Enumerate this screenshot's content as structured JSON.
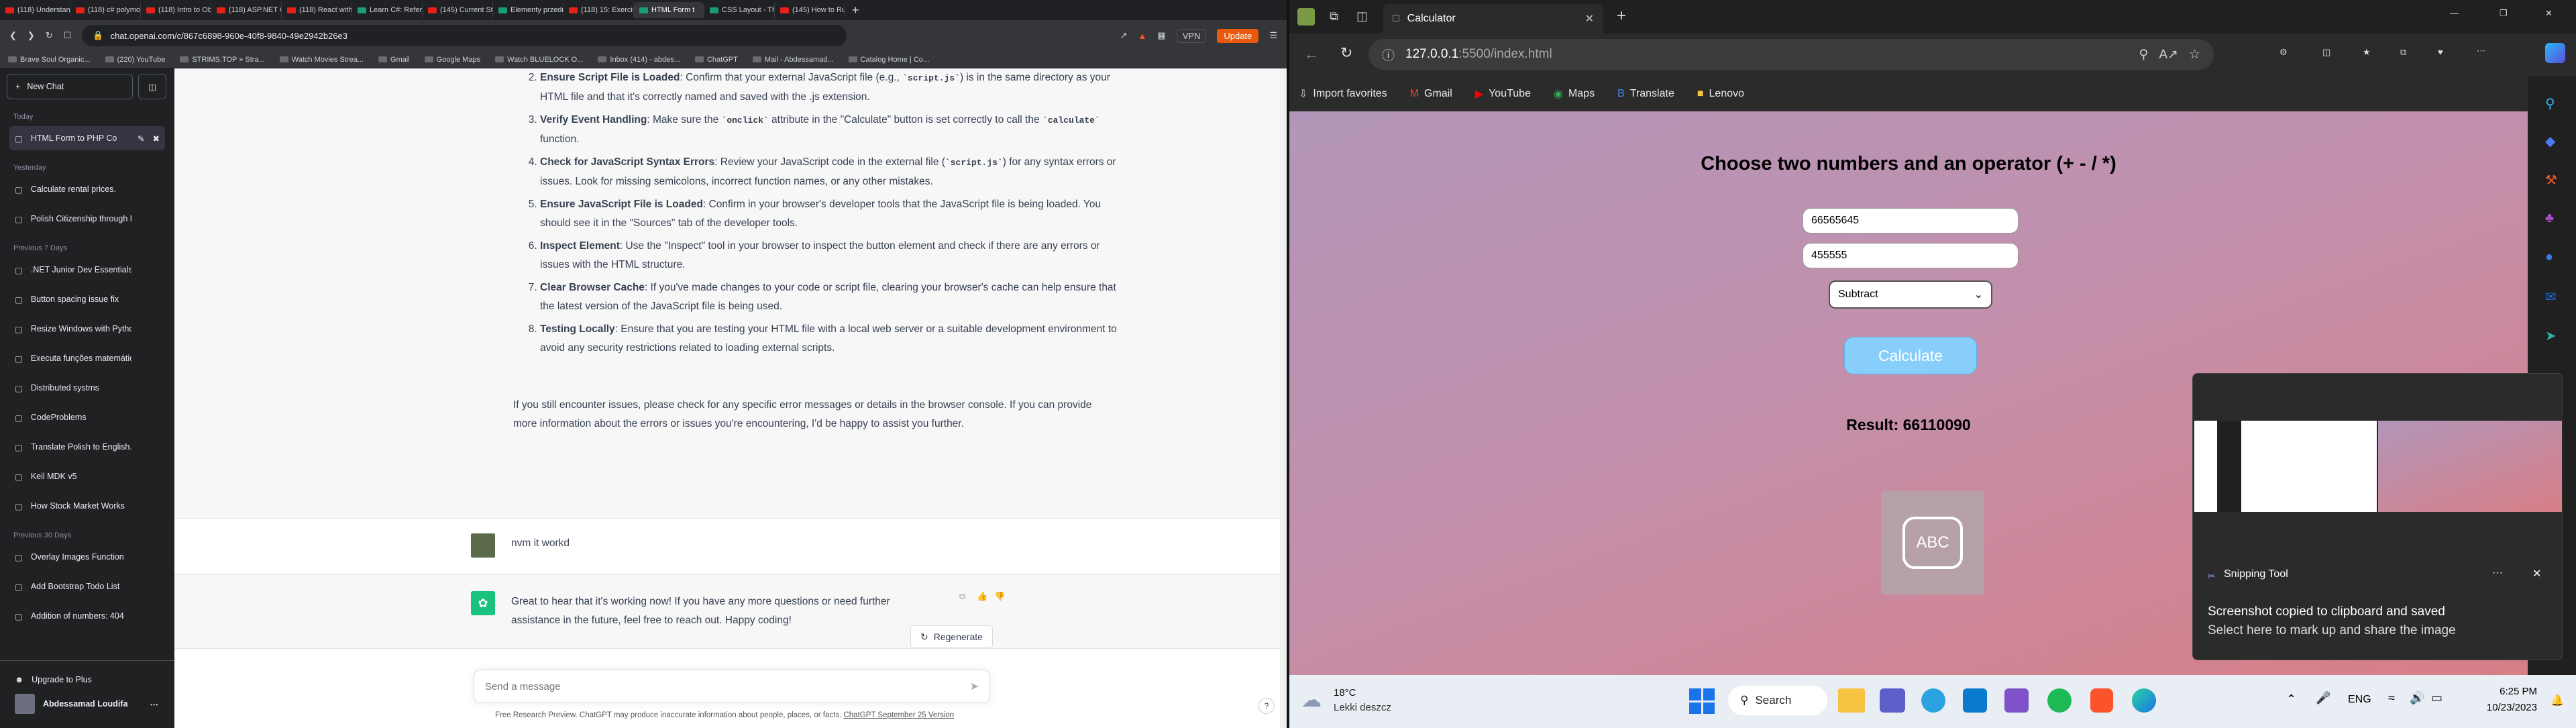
{
  "left_browser": {
    "tabs": [
      "(118) Understand",
      "(118) c# polymor",
      "(118) Intro to Obje",
      "(118) ASP.NET Co",
      "(118) React with J",
      "Learn C#: Referen",
      "(145) Current Sta",
      "Elementy przedmi",
      "(118) 15: Exercise",
      "HTML Form t",
      "CSS Layout - The",
      "(145) How to Run"
    ],
    "active_tab_index": 9,
    "url": "chat.openai.com/c/867c6898-960e-40f8-9840-49e2942b26e3",
    "vpn_label": "VPN",
    "update_label": "Update",
    "bookmarks": [
      "Brave Soul Organic...",
      "(220) YouTube",
      "STRIMS.TOP » Stra...",
      "Watch Movies Strea...",
      "Gmail",
      "Google Maps",
      "Watch BLUELOCK O...",
      "Inbox (414) - abdes...",
      "ChatGPT",
      "Mail - Abdessamad...",
      "Catalog Home | Co..."
    ]
  },
  "sidebar": {
    "new_chat_label": "New Chat",
    "groups": [
      {
        "title": "Today",
        "items": [
          "HTML Form to PHP Co"
        ]
      },
      {
        "title": "Yesterday",
        "items": [
          "Calculate rental prices.",
          "Polish Citizenship through M"
        ]
      },
      {
        "title": "Previous 7 Days",
        "items": [
          ".NET Junior Dev Essentials",
          "Button spacing issue fix",
          "Resize Windows with Python",
          "Executa funções matemátic",
          "Distributed systms",
          "CodeProblems",
          "Translate Polish to English.",
          "Keil MDK v5",
          "How Stock Market Works"
        ]
      },
      {
        "title": "Previous 30 Days",
        "items": [
          "Overlay Images Function",
          "Add Bootstrap Todo List",
          "Addition of numbers: 404"
        ]
      }
    ],
    "upgrade_label": "Upgrade to Plus",
    "user_name": "Abdessamad Loudifa"
  },
  "answer": {
    "steps": [
      {
        "bold": "Ensure Script File is Loaded",
        "text": ": Confirm that your external JavaScript file (e.g., ",
        "code": "script.js",
        "text2": ") is in the same directory as your HTML file and that it's correctly named and saved with the .js extension."
      },
      {
        "bold": "Verify Event Handling",
        "text": ": Make sure the ",
        "code": "onclick",
        "text2": " attribute in the \"Calculate\" button is set correctly to call the ",
        "code2": "calculate",
        "text3": " function."
      },
      {
        "bold": "Check for JavaScript Syntax Errors",
        "text": ": Review your JavaScript code in the external file (",
        "code": "script.js",
        "text2": ") for any syntax errors or issues. Look for missing semicolons, incorrect function names, or any other mistakes."
      },
      {
        "bold": "Ensure JavaScript File is Loaded",
        "text": ": Confirm in your browser's developer tools that the JavaScript file is being loaded. You should see it in the \"Sources\" tab of the developer tools."
      },
      {
        "bold": "Inspect Element",
        "text": ": Use the \"Inspect\" tool in your browser to inspect the button element and check if there are any errors or issues with the HTML structure."
      },
      {
        "bold": "Clear Browser Cache",
        "text": ": If you've made changes to your code or script file, clearing your browser's cache can help ensure that the latest version of the JavaScript file is being used."
      },
      {
        "bold": "Testing Locally",
        "text": ": Ensure that you are testing your HTML file with a local web server or a suitable development environment to avoid any security restrictions related to loading external scripts."
      }
    ],
    "start_number": 2,
    "closing": "If you still encounter issues, please check for any specific error messages or details in the browser console. If you can provide more information about the errors or issues you're encountering, I'd be happy to assist you further."
  },
  "user_message": "nvm it workd",
  "assistant_reply": "Great to hear that it's working now! If you have any more questions or need further assistance in the future, feel free to reach out. Happy coding!",
  "regenerate_label": "Regenerate",
  "composer_placeholder": "Send a message",
  "footer_text": "Free Research Preview. ChatGPT may produce inaccurate information about people, places, or facts.",
  "footer_link": "ChatGPT September 25 Version",
  "right_browser": {
    "tab_title": "Calculator",
    "url_host": "127.0.0.1",
    "url_rest": ":5500/index.html",
    "favorites": [
      "Import favorites",
      "Gmail",
      "YouTube",
      "Maps",
      "Translate",
      "Lenovo"
    ]
  },
  "calculator": {
    "heading": "Choose two numbers and an operator (+ - / *)",
    "num1": "66565645",
    "num2": "455555",
    "operator": "Subtract",
    "button": "Calculate",
    "result": "Result: 66110090"
  },
  "notification": {
    "app": "Snipping Tool",
    "title": "Screenshot copied to clipboard and saved",
    "body": "Select here to mark up and share the image",
    "more": "···"
  },
  "taskbar": {
    "temp": "18°C",
    "weather": "Lekki deszcz",
    "search": "Search",
    "lang": "ENG",
    "time": "6:25 PM",
    "date": "10/23/2023"
  },
  "colors": {
    "chat_sidebar": "#202123",
    "accent_green": "#19c37d",
    "calc_button": "#87cefa"
  }
}
